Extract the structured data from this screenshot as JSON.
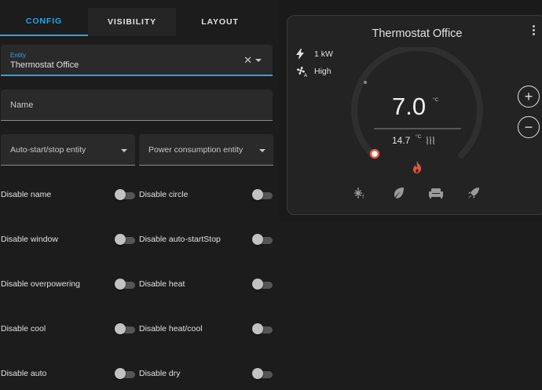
{
  "editor": {
    "tabs": [
      {
        "label": "CONFIG",
        "active": true
      },
      {
        "label": "VISIBILITY",
        "active": false
      },
      {
        "label": "LAYOUT",
        "active": false
      }
    ],
    "entity": {
      "label": "Entity",
      "value": "Thermostat Office"
    },
    "name": {
      "placeholder": "Name"
    },
    "auto_start_stop": {
      "placeholder": "Auto-start/stop entity"
    },
    "power_consumption": {
      "placeholder": "Power consumption entity"
    },
    "toggles": [
      {
        "label": "Disable name",
        "on": false
      },
      {
        "label": "Disable circle",
        "on": false
      },
      {
        "label": "Disable window",
        "on": false
      },
      {
        "label": "Disable auto-startStop",
        "on": false
      },
      {
        "label": "Disable overpowering",
        "on": false
      },
      {
        "label": "Disable heat",
        "on": false
      },
      {
        "label": "Disable cool",
        "on": false
      },
      {
        "label": "Disable heat/cool",
        "on": false
      },
      {
        "label": "Disable auto",
        "on": false
      },
      {
        "label": "Disable dry",
        "on": false
      }
    ]
  },
  "card": {
    "title": "Thermostat Office",
    "power": "1 kW",
    "fan": "High",
    "target_temp": "7.0",
    "target_unit": "°C",
    "current_temp": "14.7",
    "current_unit": "°C",
    "plus_label": "+",
    "minus_label": "−",
    "colors": {
      "accent": "#2aa3e4",
      "heat": "#e0553a",
      "ring": "#2f2f2f"
    }
  }
}
